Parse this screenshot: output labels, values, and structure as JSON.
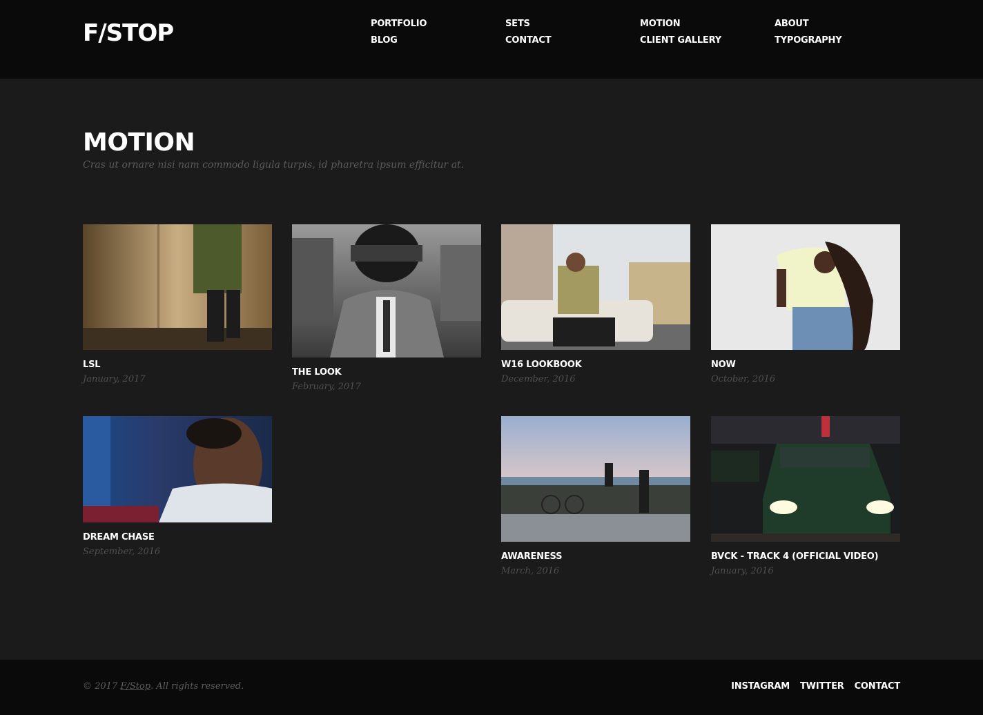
{
  "site": {
    "logo": "F/STOP"
  },
  "nav": {
    "items": [
      {
        "label": "PORTFOLIO"
      },
      {
        "label": "SETS"
      },
      {
        "label": "MOTION"
      },
      {
        "label": "ABOUT"
      },
      {
        "label": "BLOG"
      },
      {
        "label": "CONTACT"
      },
      {
        "label": "CLIENT GALLERY"
      },
      {
        "label": "TYPOGRAPHY"
      }
    ]
  },
  "page": {
    "title": "MOTION",
    "subtitle": "Cras ut ornare nisi nam commodo ligula turpis, id pharetra ipsum efficitur at."
  },
  "items": [
    {
      "title": "LSL",
      "date": "January, 2017"
    },
    {
      "title": "THE LOOK",
      "date": "February, 2017"
    },
    {
      "title": "W16 LOOKBOOK",
      "date": "December, 2016"
    },
    {
      "title": "NOW",
      "date": "October, 2016"
    },
    {
      "title": "DREAM CHASE",
      "date": "September, 2016"
    },
    {
      "title": "AWARENESS",
      "date": "March, 2016"
    },
    {
      "title": "BVCK - TRACK 4 (OFFICIAL VIDEO)",
      "date": "January, 2016"
    }
  ],
  "footer": {
    "copyright_prefix": "© 2017 ",
    "copyright_link": "F/Stop",
    "copyright_suffix": ". All rights reserved.",
    "links": [
      {
        "label": "INSTAGRAM"
      },
      {
        "label": "TWITTER"
      },
      {
        "label": "CONTACT"
      }
    ]
  },
  "colors": {
    "background": "#1b1b1b",
    "header_footer": "#0a0a0a",
    "muted_text": "#5a5a5a"
  }
}
